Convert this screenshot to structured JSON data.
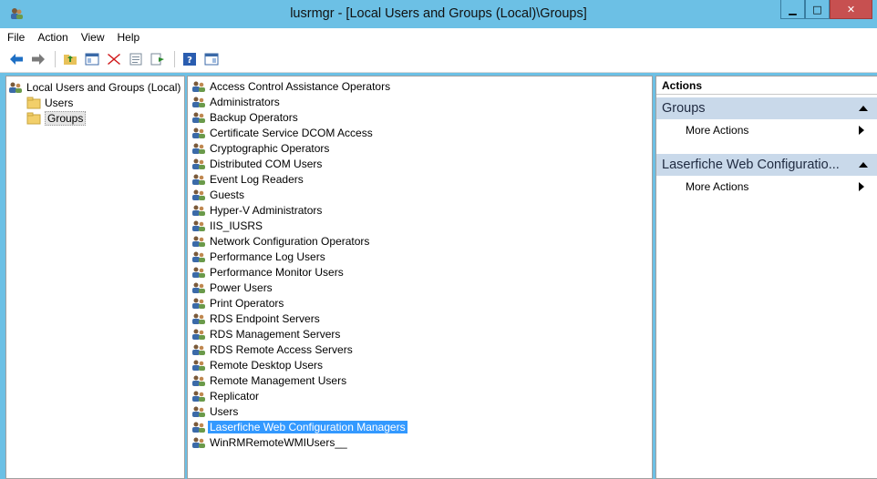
{
  "window": {
    "title": "lusrmgr - [Local Users and Groups (Local)\\Groups]",
    "minimize": "▁",
    "maximize": "□",
    "close": "✕"
  },
  "menu": [
    "File",
    "Action",
    "View",
    "Help"
  ],
  "toolbar": {
    "icons": [
      "back-arrow-icon",
      "forward-arrow-icon",
      "up-folder-icon",
      "show-hide-tree-icon",
      "delete-icon",
      "properties-icon",
      "export-list-icon",
      "help-icon",
      "show-hide-action-pane-icon"
    ]
  },
  "tree": {
    "root": "Local Users and Groups (Local)",
    "children": [
      "Users",
      "Groups"
    ],
    "selected": "Groups"
  },
  "groups": [
    "Access Control Assistance Operators",
    "Administrators",
    "Backup Operators",
    "Certificate Service DCOM Access",
    "Cryptographic Operators",
    "Distributed COM Users",
    "Event Log Readers",
    "Guests",
    "Hyper-V Administrators",
    "IIS_IUSRS",
    "Network Configuration Operators",
    "Performance Log Users",
    "Performance Monitor Users",
    "Power Users",
    "Print Operators",
    "RDS Endpoint Servers",
    "RDS Management Servers",
    "RDS Remote Access Servers",
    "Remote Desktop Users",
    "Remote Management Users",
    "Replicator",
    "Users",
    "Laserfiche Web Configuration Managers",
    "WinRMRemoteWMIUsers__"
  ],
  "selected_group": "Laserfiche Web Configuration Managers",
  "actions": {
    "header": "Actions",
    "sections": [
      {
        "title": "Groups",
        "link": "More Actions"
      },
      {
        "title": "Laserfiche Web Configuratio...",
        "link": "More Actions"
      }
    ]
  },
  "colors": {
    "titlebar": "#6cc0e5",
    "close": "#c75050",
    "selection": "#3399ff",
    "section": "#c9d9ea"
  }
}
